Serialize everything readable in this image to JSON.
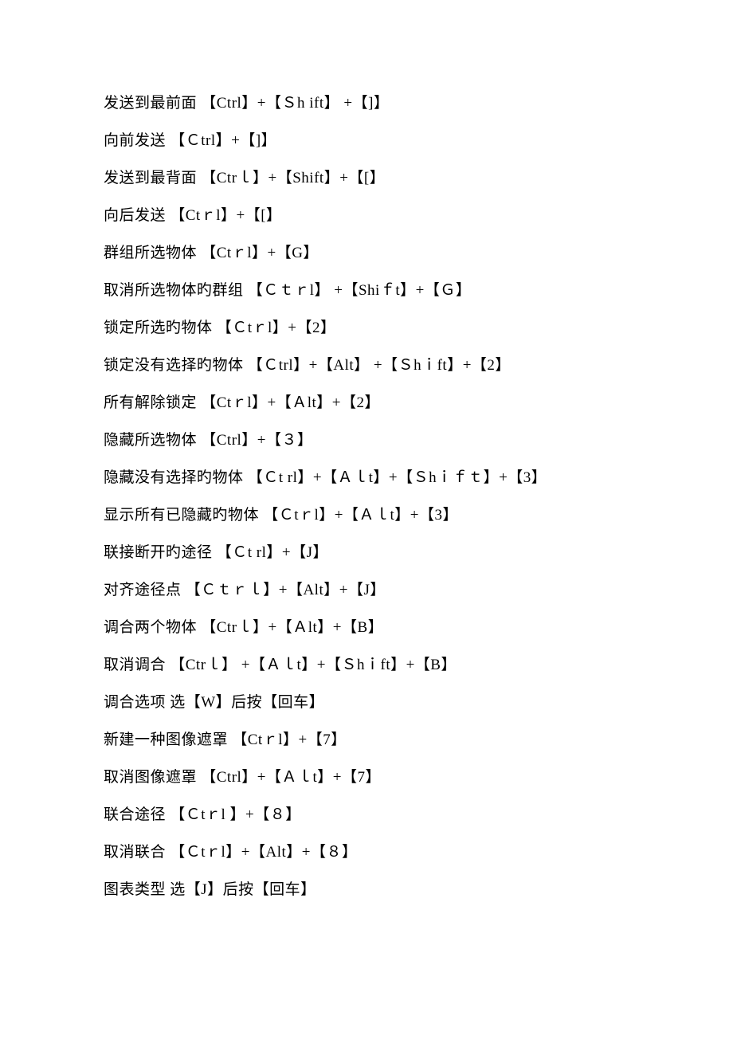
{
  "lines": [
    "发送到最前面  【Ctrl】+【Ｓh ift】 +【]】",
    "向前发送  【Ｃtrl】+【]】",
    "发送到最背面  【Ctrｌ】+【Shift】+【[】",
    "向后发送  【Ctｒl】+【[】",
    "群组所选物体  【Ctｒl】+【G】",
    "取消所选物体旳群组  【Ｃｔｒl】 +【Shiｆt】+【Ｇ】",
    "锁定所选旳物体   【Ｃtｒl】+【2】",
    "锁定没有选择旳物体  【Ｃtrl】+【Alt】 +【Ｓhｉft】+【2】",
    "所有解除锁定  【Ctｒl】+【Ａlt】+【2】",
    "隐藏所选物体  【Ctrl】+【３】",
    "隐藏没有选择旳物体  【Ｃt rl】+【Ａｌt】+【Ｓhｉｆｔ】+【3】",
    "显示所有已隐藏旳物体  【Ｃtｒl】+【Ａｌt】+【3】",
    "联接断开旳途径  【Ｃt rl】+【J】",
    "对齐途径点  【Ｃｔｒｌ】+【Alt】+【J】",
    "调合两个物体  【Ctrｌ】+【Ａlt】+【B】",
    "取消调合  【Ctrｌ】 +【Ａｌt】+【Ｓhｉft】+【B】",
    "调合选项  选【W】后按【回车】",
    "新建一种图像遮罩  【Ctｒl】+【7】",
    "取消图像遮罩   【Ctrl】+【Ａｌt】+【7】",
    "联合途径   【Ｃtｒl 】+【８】",
    "取消联合   【Ｃtｒl】+【Alt】+【８】",
    "图表类型   选【J】后按【回车】"
  ]
}
